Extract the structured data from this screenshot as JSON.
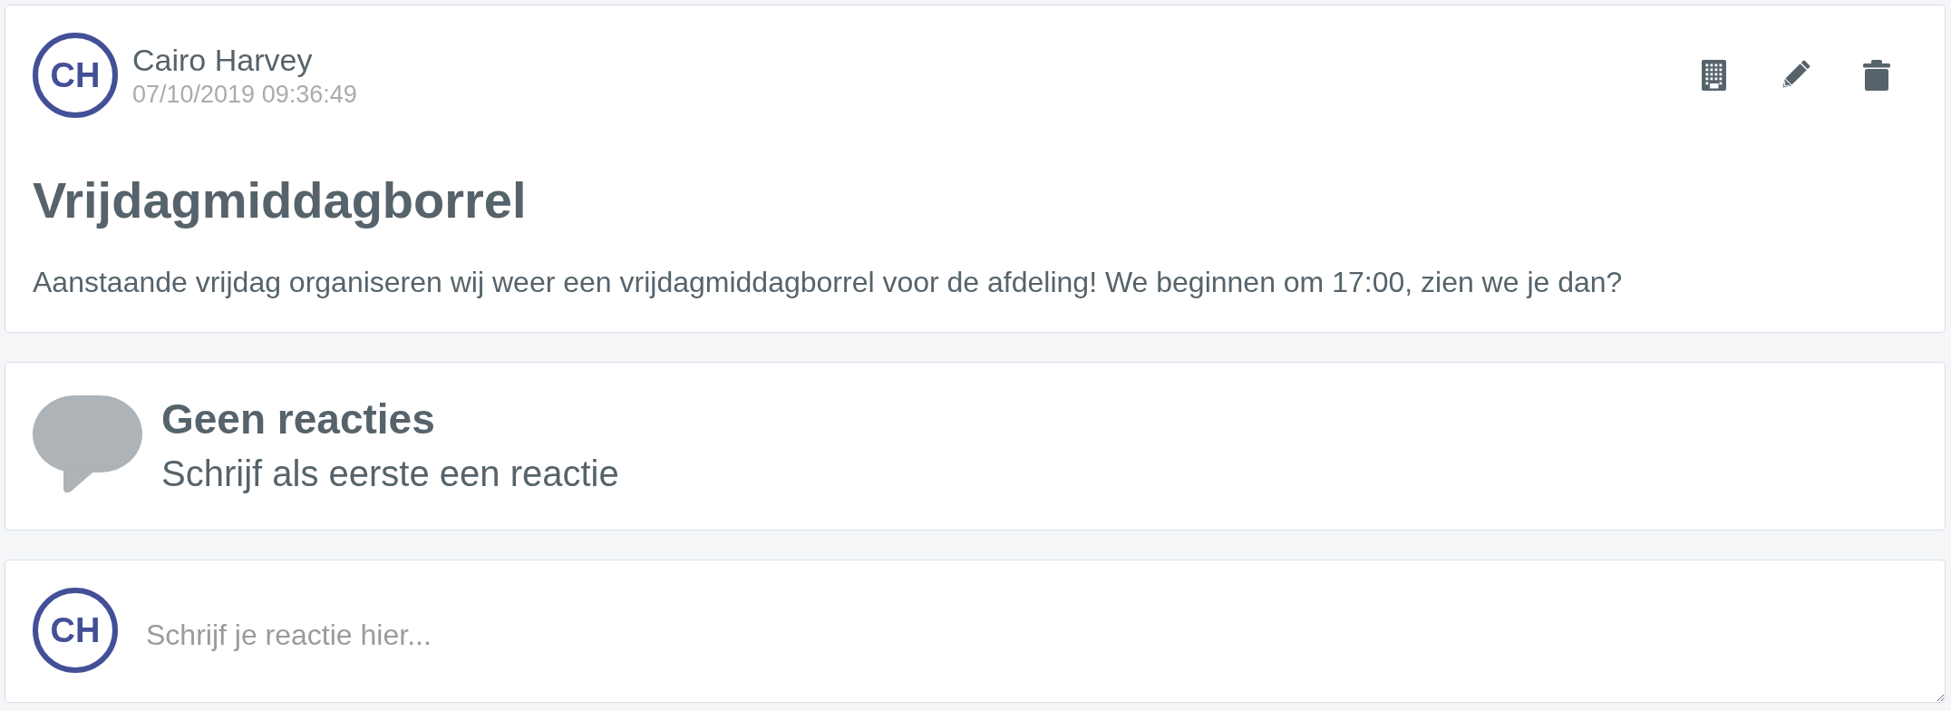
{
  "post": {
    "author": {
      "initials": "CH",
      "name": "Cairo Harvey"
    },
    "timestamp": "07/10/2019 09:36:49",
    "title": "Vrijdagmiddagborrel",
    "body": "Aanstaande vrijdag organiseren wij weer een vrijdagmiddagborrel voor de afdeling! We beginnen om 17:00, zien we je dan?"
  },
  "comments": {
    "empty_title": "Geen reacties",
    "empty_hint": "Schrijf als eerste een reactie"
  },
  "composer": {
    "initials": "CH",
    "placeholder": "Schrijf je reactie hier..."
  }
}
